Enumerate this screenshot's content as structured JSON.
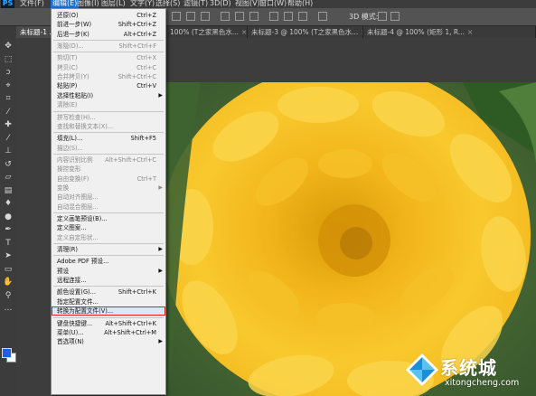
{
  "app": {
    "logo": "PS",
    "accent": "#31a8ff",
    "highlight_color": "#e02020"
  },
  "menubar": {
    "items": [
      {
        "label": "文件(F)"
      },
      {
        "label": "编辑(E)",
        "active": true
      },
      {
        "label": "图像(I)"
      },
      {
        "label": "图层(L)"
      },
      {
        "label": "文字(Y)"
      },
      {
        "label": "选择(S)"
      },
      {
        "label": "滤镜(T)"
      },
      {
        "label": "3D(D)"
      },
      {
        "label": "视图(V)"
      },
      {
        "label": "窗口(W)"
      },
      {
        "label": "帮助(H)"
      }
    ]
  },
  "options_bar": {
    "mode_3d": "3D 模式:"
  },
  "tabs": [
    {
      "label": "未标题-1 ...",
      "close": "×"
    },
    {
      "label": "100% (T之家黑色水...",
      "close": "×"
    },
    {
      "label": "未标题-3 @ 100% (T之家黑色水...",
      "close": "×"
    },
    {
      "label": "未标题-4 @ 100% (矩形 1, R...",
      "close": "×"
    }
  ],
  "tools": [
    {
      "icon": "move-tool-icon",
      "glyph": "✥"
    },
    {
      "icon": "marquee-tool-icon",
      "glyph": "⬚"
    },
    {
      "icon": "lasso-tool-icon",
      "glyph": "ↄ"
    },
    {
      "icon": "quick-select-tool-icon",
      "glyph": "⌖"
    },
    {
      "icon": "crop-tool-icon",
      "glyph": "⌗"
    },
    {
      "icon": "eyedropper-tool-icon",
      "glyph": "⁄"
    },
    {
      "icon": "healing-brush-tool-icon",
      "glyph": "✚"
    },
    {
      "icon": "brush-tool-icon",
      "glyph": "⁄"
    },
    {
      "icon": "clone-stamp-tool-icon",
      "glyph": "⊥"
    },
    {
      "icon": "history-brush-tool-icon",
      "glyph": "↺"
    },
    {
      "icon": "eraser-tool-icon",
      "glyph": "▱"
    },
    {
      "icon": "gradient-tool-icon",
      "glyph": "▤"
    },
    {
      "icon": "blur-tool-icon",
      "glyph": "♦"
    },
    {
      "icon": "dodge-tool-icon",
      "glyph": "●"
    },
    {
      "icon": "pen-tool-icon",
      "glyph": "✒"
    },
    {
      "icon": "type-tool-icon",
      "glyph": "T"
    },
    {
      "icon": "path-select-tool-icon",
      "glyph": "➤"
    },
    {
      "icon": "shape-tool-icon",
      "glyph": "▭"
    },
    {
      "icon": "hand-tool-icon",
      "glyph": "✋"
    },
    {
      "icon": "zoom-tool-icon",
      "glyph": "⚲"
    },
    {
      "icon": "more-tools-icon",
      "glyph": "…"
    }
  ],
  "swatches": {
    "foreground": "#1466d6",
    "background": "#ffffff"
  },
  "menu": {
    "items": [
      {
        "label": "还原(O)",
        "shortcut": "Ctrl+Z"
      },
      {
        "label": "前进一步(W)",
        "shortcut": "Shift+Ctrl+Z"
      },
      {
        "label": "后退一步(K)",
        "shortcut": "Alt+Ctrl+Z"
      },
      {
        "sep": true
      },
      {
        "label": "渐隐(D)...",
        "shortcut": "Shift+Ctrl+F",
        "disabled": true
      },
      {
        "sep": true
      },
      {
        "label": "剪切(T)",
        "shortcut": "Ctrl+X",
        "disabled": true
      },
      {
        "label": "拷贝(C)",
        "shortcut": "Ctrl+C",
        "disabled": true
      },
      {
        "label": "合并拷贝(Y)",
        "shortcut": "Shift+Ctrl+C",
        "disabled": true
      },
      {
        "label": "粘贴(P)",
        "shortcut": "Ctrl+V"
      },
      {
        "label": "选择性粘贴(I)",
        "submenu": true
      },
      {
        "label": "清除(E)",
        "disabled": true
      },
      {
        "sep": true
      },
      {
        "label": "拼写检查(H)...",
        "disabled": true
      },
      {
        "label": "查找和替换文本(X)...",
        "disabled": true
      },
      {
        "sep": true
      },
      {
        "label": "填充(L)...",
        "shortcut": "Shift+F5"
      },
      {
        "label": "描边(S)...",
        "disabled": true
      },
      {
        "sep": true
      },
      {
        "label": "内容识别比例",
        "shortcut": "Alt+Shift+Ctrl+C",
        "disabled": true
      },
      {
        "label": "操控变形",
        "disabled": true
      },
      {
        "label": "自由变换(F)",
        "shortcut": "Ctrl+T",
        "disabled": true
      },
      {
        "label": "变换",
        "submenu": true,
        "disabled": true
      },
      {
        "label": "自动对齐图层...",
        "disabled": true
      },
      {
        "label": "自动混合图层...",
        "disabled": true
      },
      {
        "sep": true
      },
      {
        "label": "定义画笔预设(B)..."
      },
      {
        "label": "定义图案..."
      },
      {
        "label": "定义自定形状...",
        "disabled": true
      },
      {
        "sep": true
      },
      {
        "label": "清理(R)",
        "submenu": true
      },
      {
        "sep": true
      },
      {
        "label": "Adobe PDF 预设..."
      },
      {
        "label": "预设",
        "submenu": true
      },
      {
        "label": "远程连接..."
      },
      {
        "sep": true
      },
      {
        "label": "颜色设置(G)...",
        "shortcut": "Shift+Ctrl+K"
      },
      {
        "label": "指定配置文件..."
      },
      {
        "label": "转换为配置文件(V)...",
        "highlight": true
      },
      {
        "sep": true
      },
      {
        "label": "键盘快捷键...",
        "shortcut": "Alt+Shift+Ctrl+K"
      },
      {
        "label": "菜单(U)...",
        "shortcut": "Alt+Shift+Ctrl+M"
      },
      {
        "label": "首选项(N)",
        "submenu": true
      }
    ]
  },
  "watermark": {
    "text": "系统城",
    "url": "xitongcheng.com"
  }
}
